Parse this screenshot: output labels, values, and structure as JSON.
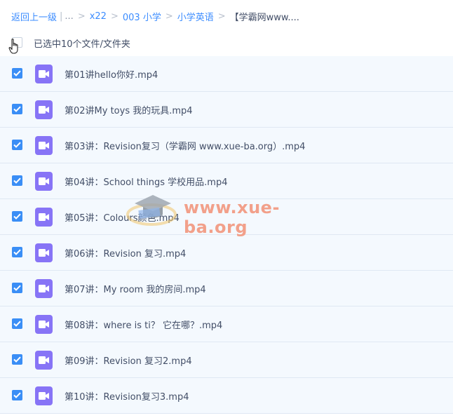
{
  "breadcrumb": {
    "back": "返回上一级",
    "sep": "|",
    "ellipsis": "...",
    "crumbs": [
      "x22",
      "003 小学",
      "小学英语"
    ],
    "current": "【学霸网www...."
  },
  "selection": {
    "label": "已选中10个文件/文件夹"
  },
  "files": [
    {
      "name": "第01讲hello你好.mp4"
    },
    {
      "name": "第02讲My toys 我的玩具.mp4"
    },
    {
      "name": "第03讲：Revision复习（学霸网 www.xue-ba.org）.mp4"
    },
    {
      "name": "第04讲：School things 学校用品.mp4"
    },
    {
      "name": "第05讲：Colours颜色.mp4"
    },
    {
      "name": "第06讲：Revision 复习.mp4"
    },
    {
      "name": "第07讲：My room 我的房间.mp4"
    },
    {
      "name": "第08讲：where is ti？ 它在哪？.mp4"
    },
    {
      "name": "第09讲：Revision 复习2.mp4"
    },
    {
      "name": "第10讲：Revision复习3.mp4"
    }
  ],
  "watermark": {
    "text": "www.xue-ba.org"
  },
  "colors": {
    "accent": "#3a8ef6",
    "video_icon": "#8774f6",
    "row_bg": "#f4f9fe"
  }
}
